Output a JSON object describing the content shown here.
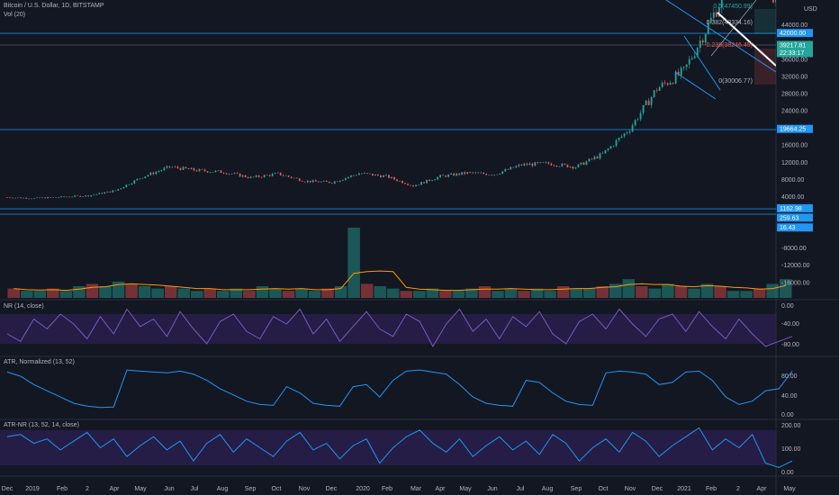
{
  "header": {
    "symbol_title": "Bitcoin / U.S. Dollar, 1D, BITSTAMP",
    "volume_label": "Vol (20)"
  },
  "panes": {
    "nr_label": "NR (14, close)",
    "atr_label": "ATR, Normalized (13, 52)",
    "atrnr_label": "ATR-NR (13, 52, 14, close)"
  },
  "price_axis": {
    "currency": "USD",
    "ticks": [
      "44000.00",
      "36000.00",
      "32000.00",
      "28000.00",
      "24000.00",
      "16000.00",
      "12000.00",
      "8000.00",
      "4000.00",
      "-8000.00",
      "-12000.00",
      "-16000.00"
    ],
    "tick_values": [
      44000,
      36000,
      32000,
      28000,
      24000,
      16000,
      12000,
      8000,
      4000,
      -8000,
      -12000,
      -16000
    ],
    "tags": [
      {
        "text": "42000.00",
        "value": 42000,
        "color": "#2196f3"
      },
      {
        "text": "39217.81",
        "sub": "22:33:17",
        "value": 39217.81,
        "color": "#26a69a"
      },
      {
        "text": "19664.25",
        "value": 19664.25,
        "color": "#2196f3"
      },
      {
        "text": "1162.98",
        "value": 1162.98,
        "color": "#2196f3"
      },
      {
        "text": "259.63",
        "value": -1000,
        "color": "#2196f3"
      },
      {
        "text": "16.43",
        "value": -3300,
        "color": "#2196f3"
      }
    ]
  },
  "fib": {
    "levels": [
      "0.5(47450.99)",
      "0.382(43334.16)",
      "0.236(38246.45)",
      "0(30006.77)"
    ]
  },
  "nr_axis": [
    "0.00",
    "-40.00",
    "-80.00"
  ],
  "atr_axis": [
    "80.00",
    "40.00",
    "0.00"
  ],
  "atrnr_axis": [
    "200.00",
    "100.00",
    "0.00"
  ],
  "time_axis": [
    "Dec",
    "2019",
    "Feb",
    "2",
    "Apr",
    "May",
    "Jun",
    "Jul",
    "Aug",
    "Sep",
    "Oct",
    "Nov",
    "Dec",
    "2020",
    "Feb",
    "Mar",
    "Apr",
    "May",
    "Jun",
    "Jul",
    "Aug",
    "Sep",
    "Oct",
    "Nov",
    "Dec",
    "2021",
    "Feb",
    "2",
    "Apr",
    "May"
  ],
  "colors": {
    "up": "#26a69a",
    "down": "#ef5350",
    "line": "#2196f3",
    "nr_line": "#7e57c2",
    "band": "#2a1f4f",
    "vol_ma": "#ff9800",
    "background": "#131722"
  },
  "chart_data": [
    {
      "type": "candlestick",
      "title": "Bitcoin / U.S. Dollar, 1D, BITSTAMP",
      "x": [
        "2018-12",
        "2019-01",
        "2019-02",
        "2019-03",
        "2019-04",
        "2019-05",
        "2019-06",
        "2019-07",
        "2019-08",
        "2019-09",
        "2019-10",
        "2019-11",
        "2019-12",
        "2020-01",
        "2020-02",
        "2020-03",
        "2020-04",
        "2020-05",
        "2020-06",
        "2020-07",
        "2020-08",
        "2020-09",
        "2020-10",
        "2020-11",
        "2020-12",
        "2021-01",
        "2021-02",
        "2021-03",
        "2021-04",
        "2021-05"
      ],
      "close": [
        3700,
        3500,
        3800,
        4100,
        5300,
        8500,
        10800,
        10000,
        9600,
        8300,
        9200,
        7500,
        7200,
        9300,
        8600,
        6400,
        8600,
        9400,
        9100,
        11300,
        11600,
        10800,
        13800,
        19700,
        29000,
        33000,
        45000,
        58000,
        57000,
        37000
      ],
      "ylim": [
        -18000,
        50000
      ]
    },
    {
      "type": "bar",
      "name": "Vol (20)",
      "values": [
        4,
        3,
        3,
        4,
        3,
        5,
        6,
        5,
        7,
        6,
        5,
        4,
        5,
        4,
        3,
        4,
        3,
        4,
        3,
        5,
        4,
        3,
        4,
        3,
        4,
        5,
        30,
        6,
        5,
        4,
        3,
        3,
        4,
        3,
        3,
        4,
        5,
        3,
        4,
        3,
        4,
        3,
        5,
        4,
        4,
        5,
        6,
        8,
        5,
        4,
        6,
        5,
        4,
        6,
        5,
        3,
        3,
        4,
        6,
        8
      ]
    },
    {
      "type": "line",
      "name": "NR (14, close)",
      "ylim": [
        -90,
        0
      ],
      "values": [
        -60,
        -75,
        -30,
        -50,
        -20,
        -40,
        -70,
        -25,
        -60,
        -10,
        -45,
        -30,
        -65,
        -15,
        -50,
        -80,
        -35,
        -20,
        -55,
        -70,
        -25,
        -40,
        -10,
        -60,
        -30,
        -75,
        -45,
        -15,
        -50,
        -65,
        -20,
        -35,
        -85,
        -40,
        -10,
        -55,
        -30,
        -70,
        -25,
        -45,
        -15,
        -60,
        -80,
        -35,
        -20,
        -50,
        -10,
        -40,
        -65,
        -30,
        -20,
        -55,
        -15,
        -45,
        -70,
        -30,
        -60,
        -85,
        -75,
        -65
      ]
    },
    {
      "type": "line",
      "name": "ATR, Normalized (13, 52)",
      "ylim": [
        0,
        100
      ],
      "values": [
        90,
        80,
        60,
        45,
        30,
        15,
        8,
        5,
        6,
        95,
        92,
        90,
        88,
        92,
        85,
        70,
        50,
        35,
        20,
        12,
        10,
        55,
        40,
        15,
        10,
        8,
        55,
        60,
        30,
        70,
        92,
        95,
        90,
        85,
        60,
        30,
        15,
        10,
        8,
        70,
        65,
        40,
        20,
        12,
        10,
        88,
        92,
        90,
        85,
        60,
        65,
        90,
        92,
        70,
        30,
        12,
        20,
        45,
        50,
        92
      ]
    },
    {
      "type": "line",
      "name": "ATR-NR (13, 52, 14, close)",
      "ylim": [
        0,
        200
      ],
      "values": [
        150,
        160,
        120,
        140,
        90,
        130,
        170,
        100,
        140,
        60,
        110,
        150,
        90,
        130,
        40,
        120,
        160,
        80,
        140,
        100,
        60,
        130,
        170,
        90,
        120,
        50,
        110,
        140,
        30,
        100,
        150,
        180,
        120,
        80,
        140,
        60,
        110,
        150,
        90,
        130,
        70,
        160,
        120,
        40,
        100,
        140,
        80,
        170,
        130,
        60,
        110,
        150,
        190,
        90,
        140,
        100,
        160,
        30,
        10,
        40
      ]
    }
  ]
}
